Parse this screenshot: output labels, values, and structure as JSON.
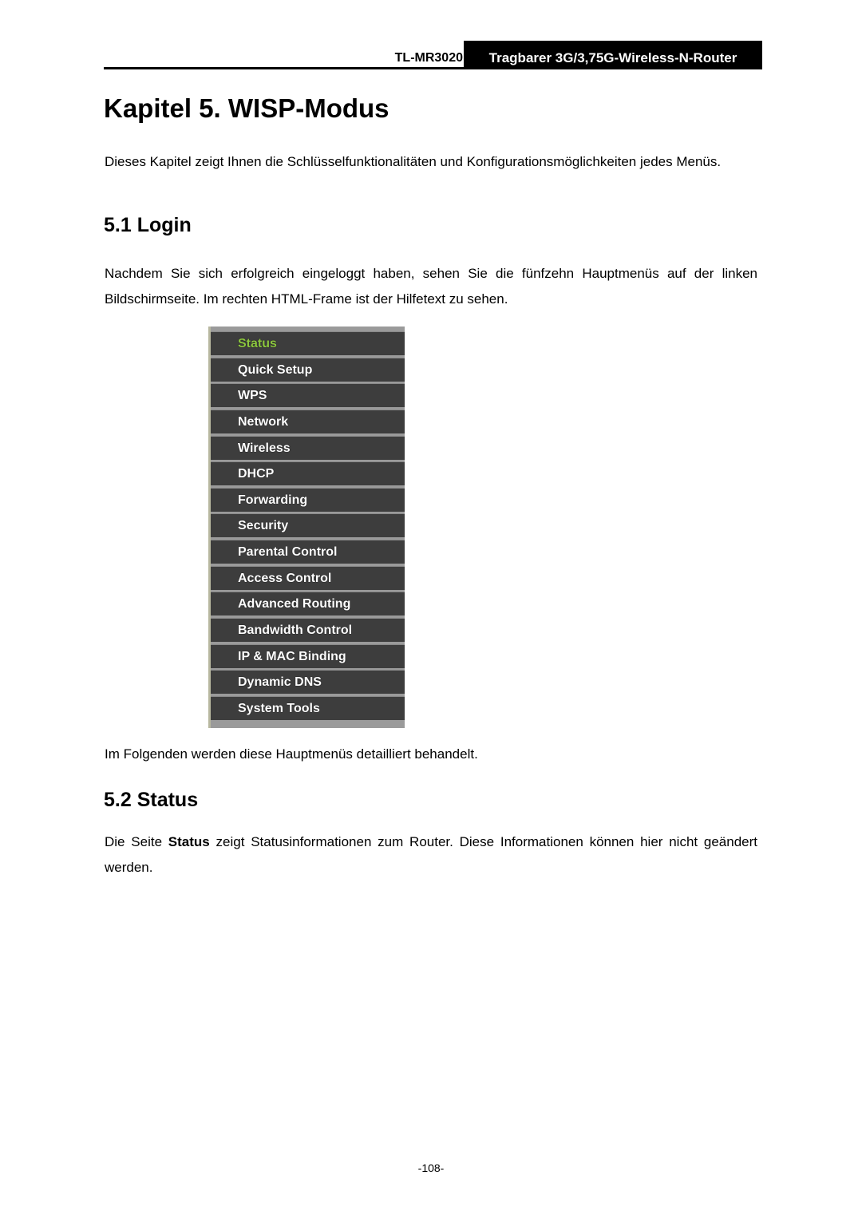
{
  "header": {
    "model": "TL-MR3020",
    "product": "Tragbarer 3G/3,75G-Wireless-N-Router"
  },
  "chapter": {
    "title": "Kapitel 5.  WISP-Modus",
    "intro": "Dieses Kapitel zeigt Ihnen die Schlüsselfunktionalitäten und Konfigurationsmöglichkeiten jedes Menüs."
  },
  "sections": [
    {
      "title": "5.1  Login",
      "text": "Nachdem Sie sich erfolgreich eingeloggt haben, sehen Sie die fünfzehn Hauptmenüs auf der linken Bildschirmseite. Im rechten HTML-Frame ist der Hilfetext zu sehen.",
      "after_text": "Im Folgenden werden diese Hauptmenüs detailliert behandelt."
    },
    {
      "title": "5.2  Status",
      "text_prefix": "Die Seite ",
      "text_bold": "Status",
      "text_suffix": " zeigt Statusinformationen zum Router. Diese Informationen können hier nicht geändert werden."
    }
  ],
  "menu": {
    "active_color": "#8cc63f",
    "items": [
      {
        "label": "Status",
        "active": true
      },
      {
        "label": "Quick Setup"
      },
      {
        "label": "WPS"
      },
      {
        "label": "Network"
      },
      {
        "label": "Wireless"
      },
      {
        "label": "DHCP"
      },
      {
        "label": "Forwarding"
      },
      {
        "label": "Security"
      },
      {
        "label": "Parental Control"
      },
      {
        "label": "Access Control"
      },
      {
        "label": "Advanced Routing"
      },
      {
        "label": "Bandwidth Control"
      },
      {
        "label": "IP & MAC Binding"
      },
      {
        "label": "Dynamic DNS"
      },
      {
        "label": "System Tools"
      }
    ]
  },
  "footer": {
    "page_number": "-108-"
  }
}
